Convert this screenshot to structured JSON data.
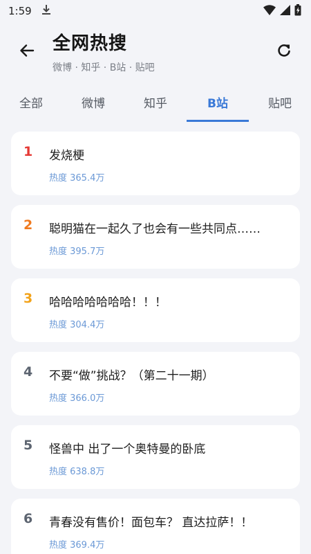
{
  "status_bar": {
    "time": "1:59"
  },
  "header": {
    "title": "全网热搜",
    "subtitle": "微博 · 知乎 · B站 · 贴吧"
  },
  "tabs": [
    {
      "label": "全部",
      "active": false
    },
    {
      "label": "微博",
      "active": false
    },
    {
      "label": "知乎",
      "active": false
    },
    {
      "label": "B站",
      "active": true
    },
    {
      "label": "贴吧",
      "active": false
    }
  ],
  "colors": {
    "accent": "#3a79d7",
    "rank1": "#e53935",
    "rank2": "#f07a1f",
    "rank3": "#f2a31b",
    "rank_other": "#5c6470",
    "heat": "#6b99d6"
  },
  "items": [
    {
      "rank": "1",
      "title": "发烧梗",
      "heat": "热度 365.4万"
    },
    {
      "rank": "2",
      "title": "聪明猫在一起久了也会有一些共同点……",
      "heat": "热度 395.7万"
    },
    {
      "rank": "3",
      "title": "哈哈哈哈哈哈哈！！！",
      "heat": "热度 304.4万"
    },
    {
      "rank": "4",
      "title": "不要“做”挑战？（第二十一期）",
      "heat": "热度 366.0万"
    },
    {
      "rank": "5",
      "title": "怪兽中 出了一个奥特曼的卧底",
      "heat": "热度 638.8万"
    },
    {
      "rank": "6",
      "title": "青春没有售价！面包车？ 直达拉萨！！",
      "heat": "热度 369.4万"
    }
  ]
}
